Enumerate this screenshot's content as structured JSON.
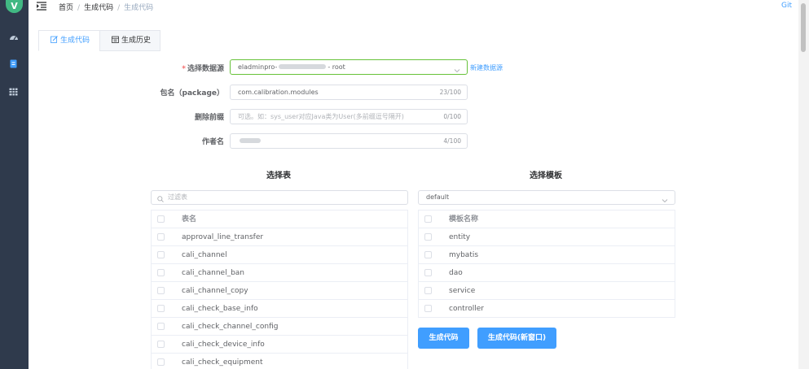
{
  "sidebar": {
    "logo_letter": "V",
    "icons": [
      "dashboard-icon",
      "document-icon",
      "table-icon"
    ]
  },
  "header": {
    "breadcrumb": [
      "首页",
      "生成代码",
      "生成代码"
    ],
    "git_label": "Git"
  },
  "tabs": [
    {
      "label": "生成代码",
      "icon": "edit-icon"
    },
    {
      "label": "生成历史",
      "icon": "calendar-icon"
    }
  ],
  "form": {
    "datasource": {
      "label": "选择数据源",
      "value_prefix": "eladminpro-",
      "value_suffix": "- root",
      "new_link": "新建数据源"
    },
    "package": {
      "label": "包名（package）",
      "value": "com.calibration.modules",
      "count": "23/100"
    },
    "prefix": {
      "label": "删除前缀",
      "placeholder": "可选。如：sys_user对应Java类为User(多前缀逗号隔开)",
      "count": "0/100"
    },
    "author": {
      "label": "作者名",
      "count": "4/100"
    }
  },
  "tables_section": {
    "title": "选择表",
    "filter_placeholder": "过滤表",
    "header": "表名",
    "rows": [
      "approval_line_transfer",
      "cali_channel",
      "cali_channel_ban",
      "cali_channel_copy",
      "cali_check_base_info",
      "cali_check_channel_config",
      "cali_check_device_info",
      "cali_check_equipment"
    ]
  },
  "templates_section": {
    "title": "选择模板",
    "selected": "default",
    "header": "模板名称",
    "rows": [
      "entity",
      "mybatis",
      "dao",
      "service",
      "controller"
    ]
  },
  "buttons": {
    "generate": "生成代码",
    "generate_new_window": "生成代码(新窗口)"
  },
  "colors": {
    "primary": "#409eff",
    "sidebar": "#2f3a4c",
    "success": "#67c23a"
  }
}
